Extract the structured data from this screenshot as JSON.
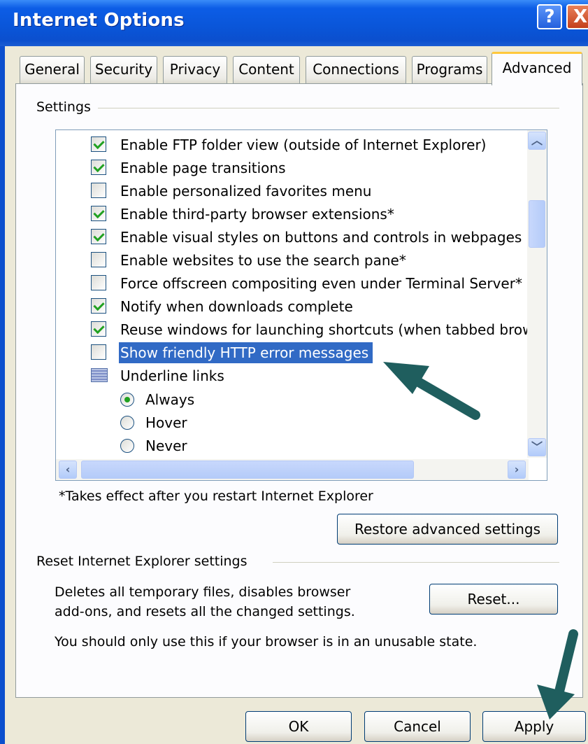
{
  "window": {
    "title": "Internet Options",
    "help_label": "?",
    "close_label": "X"
  },
  "tabs": [
    {
      "label": "General",
      "active": false
    },
    {
      "label": "Security",
      "active": false
    },
    {
      "label": "Privacy",
      "active": false
    },
    {
      "label": "Content",
      "active": false
    },
    {
      "label": "Connections",
      "active": false
    },
    {
      "label": "Programs",
      "active": false
    },
    {
      "label": "Advanced",
      "active": true
    }
  ],
  "settings": {
    "group_label": "Settings",
    "items": [
      {
        "label": "Enable FTP folder view (outside of Internet Explorer)",
        "checked": true
      },
      {
        "label": "Enable page transitions",
        "checked": true
      },
      {
        "label": "Enable personalized favorites menu",
        "checked": false
      },
      {
        "label": "Enable third-party browser extensions*",
        "checked": true
      },
      {
        "label": "Enable visual styles on buttons and controls in webpages",
        "checked": true
      },
      {
        "label": "Enable websites to use the search pane*",
        "checked": false
      },
      {
        "label": "Force offscreen compositing even under Terminal Server*",
        "checked": false
      },
      {
        "label": "Notify when downloads complete",
        "checked": true
      },
      {
        "label": "Reuse windows for launching shortcuts (when tabbed brow",
        "checked": true
      },
      {
        "label": "Show friendly HTTP error messages",
        "checked": false,
        "selected": true
      }
    ],
    "underline_group": "Underline links",
    "underline_options": [
      {
        "label": "Always",
        "selected": true
      },
      {
        "label": "Hover",
        "selected": false
      },
      {
        "label": "Never",
        "selected": false
      }
    ],
    "footnote": "*Takes effect after you restart Internet Explorer",
    "restore_button": "Restore advanced settings"
  },
  "reset": {
    "group_label": "Reset Internet Explorer settings",
    "desc_line1": "Deletes all temporary files, disables browser",
    "desc_line2": "add-ons, and resets all the changed settings.",
    "warning": "You should only use this if your browser is in an unusable state.",
    "reset_button": "Reset..."
  },
  "footer": {
    "ok": "OK",
    "cancel": "Cancel",
    "apply": "Apply"
  },
  "colors": {
    "titlebar": "#0b4fce",
    "selection": "#316ac5",
    "annotation_arrow": "#1f5e5e"
  }
}
